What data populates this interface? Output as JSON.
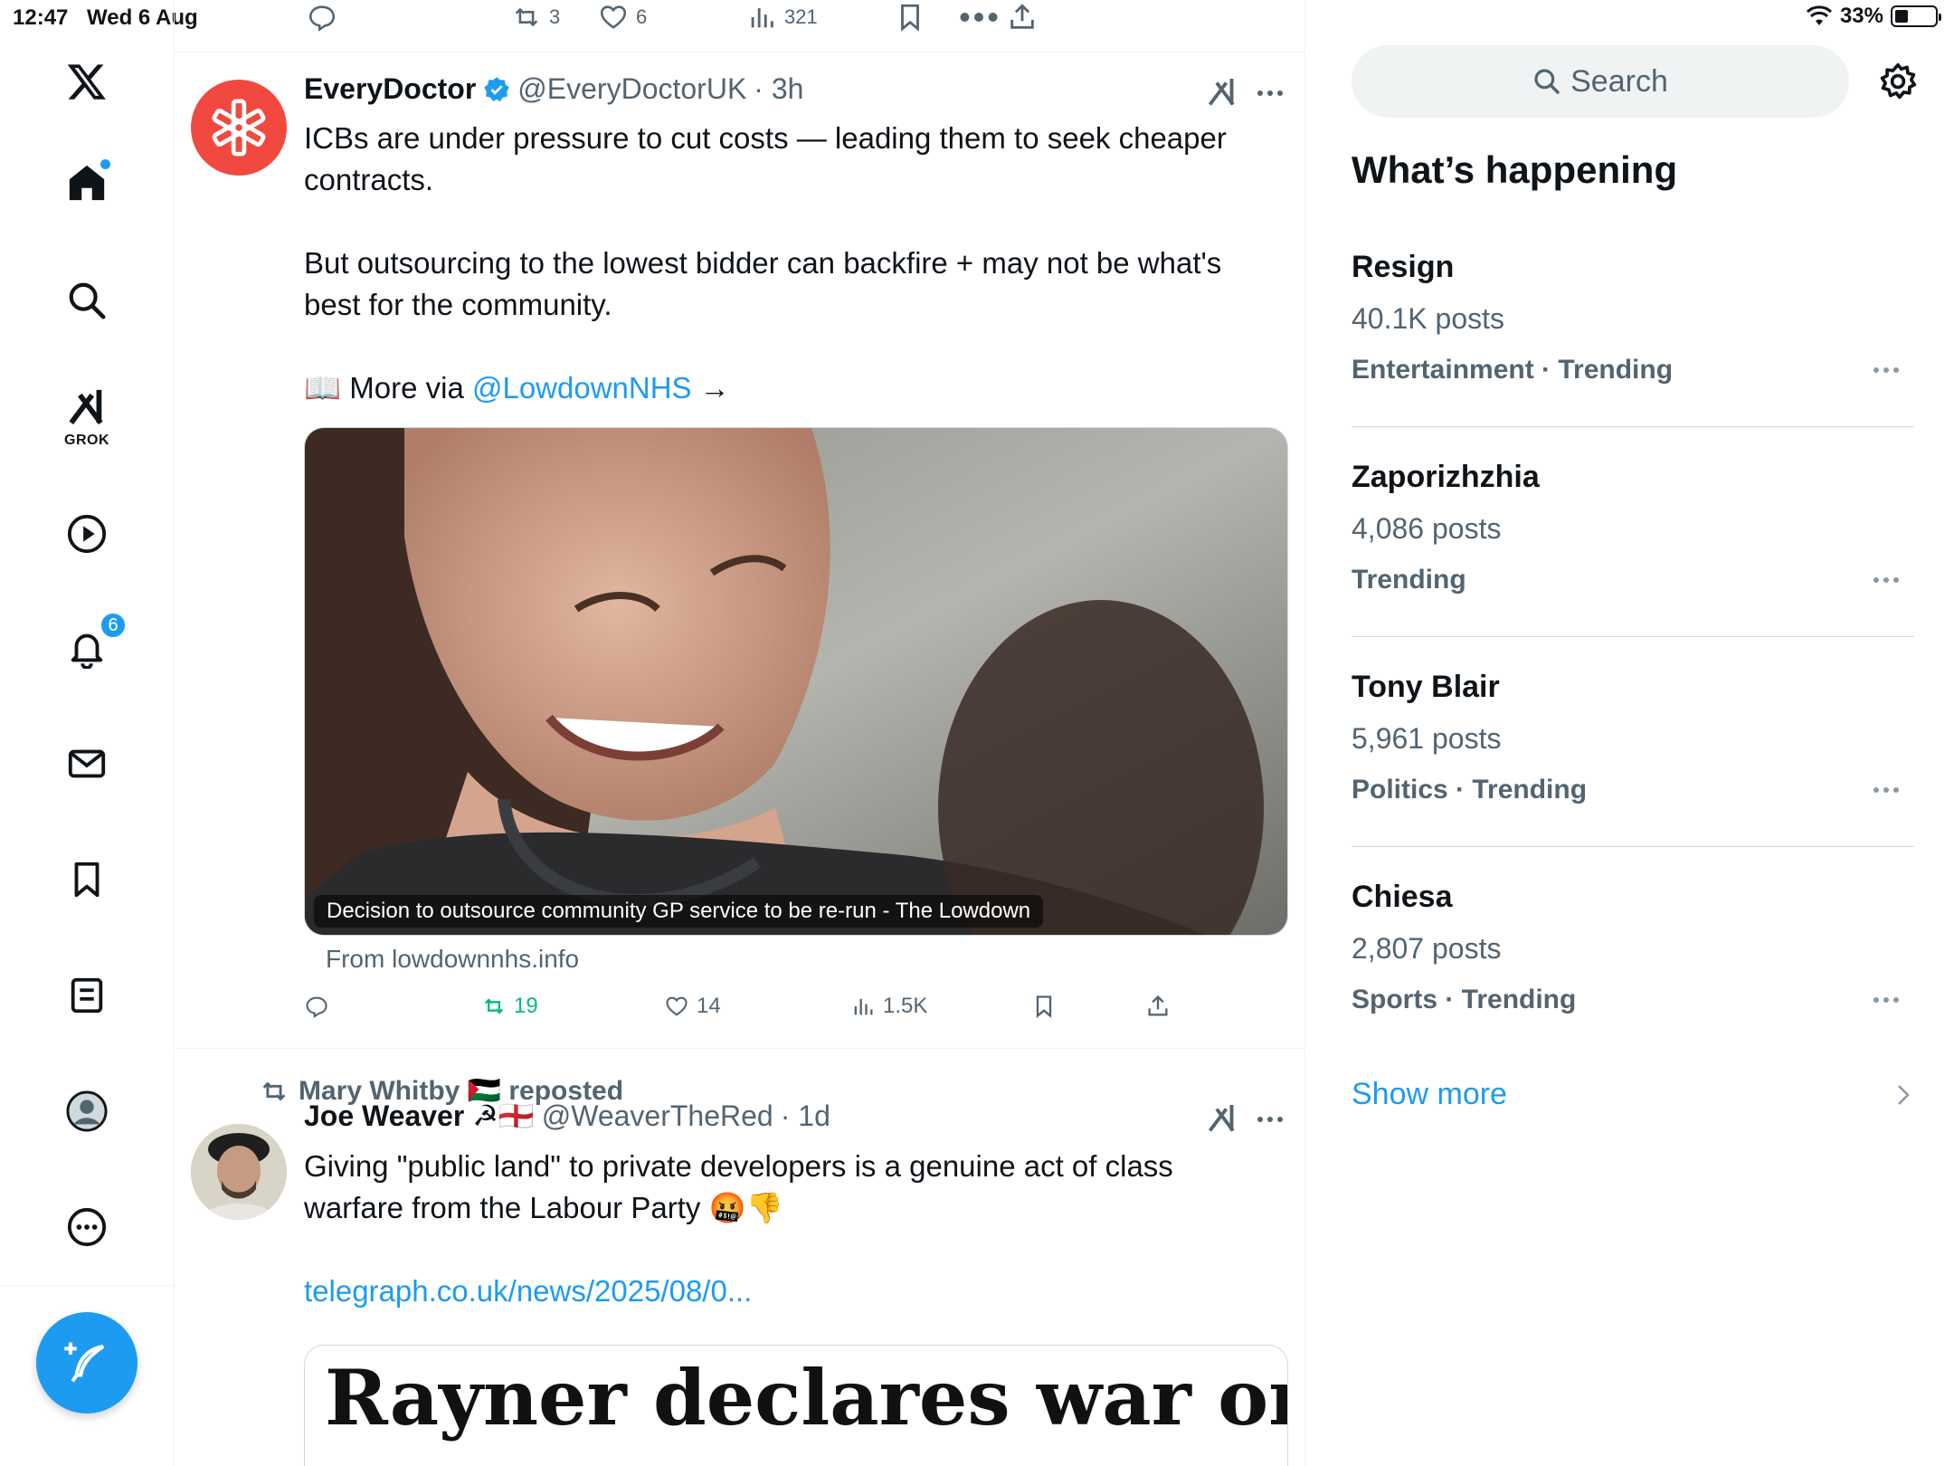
{
  "status": {
    "time": "12:47",
    "date": "Wed 6 Aug",
    "battery": "33%",
    "battery_level": 0.33
  },
  "nav": {
    "grok_label": "GROK",
    "notifications_badge": "6"
  },
  "top_actions": {
    "retweets": "3",
    "likes": "6",
    "views": "321"
  },
  "tweet1": {
    "name": "EveryDoctor",
    "handle": "@EveryDoctorUK",
    "time": "· 3h",
    "line1": "ICBs are under pressure to cut costs — leading them to seek cheaper",
    "line2": "contracts.",
    "line3": "But outsourcing to the lowest bidder can backfire + may not be what's",
    "line4": "best for the community.",
    "more_prefix": "📖 More via ",
    "more_link": "@LowdownNHS",
    "more_suffix": " →",
    "card_caption": "Decision to outsource community GP service to be re-run - The Lowdown",
    "card_from": "From lowdownnhs.info",
    "retweets": "19",
    "likes": "14",
    "views": "1.5K"
  },
  "tweet2": {
    "reposted_by": "Mary Whitby 🇵🇸 reposted",
    "name": "Joe Weaver ☭🏴󠁧󠁢󠁥󠁮󠁧󠁿",
    "handle": "@WeaverTheRed",
    "time": "· 1d",
    "line1": "Giving \"public land\" to private developers is a genuine act of class",
    "line2": "warfare from the Labour Party 🤬👎",
    "link": "telegraph.co.uk/news/2025/08/0...",
    "card_headline": "Rayner declares war on"
  },
  "right": {
    "search_placeholder": "Search",
    "title": "What’s happening",
    "trends": [
      {
        "name": "Resign",
        "count": "40.1K posts",
        "category": "Entertainment · Trending"
      },
      {
        "name": "Zaporizhzhia",
        "count": "4,086 posts",
        "category": "Trending"
      },
      {
        "name": "Tony Blair",
        "count": "5,961 posts",
        "category": "Politics · Trending"
      },
      {
        "name": "Chiesa",
        "count": "2,807 posts",
        "category": "Sports · Trending"
      }
    ],
    "show_more": "Show more"
  },
  "colors": {
    "accent": "#1d9bf0",
    "retweet_green": "#00ba7c",
    "everydoctor_red": "#f1493f",
    "muted": "#536471"
  }
}
